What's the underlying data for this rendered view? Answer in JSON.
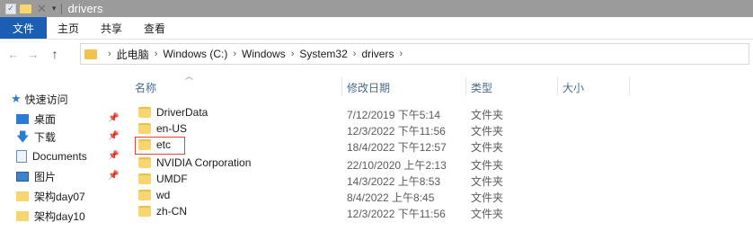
{
  "window": {
    "title": "drivers"
  },
  "quick_access_toolbar": {
    "checkbox_glyph": "✓",
    "delete_glyph": "✕",
    "dropdown_glyph": "▾"
  },
  "ribbon": {
    "tabs": [
      "文件",
      "主页",
      "共享",
      "查看"
    ]
  },
  "nav": {
    "back": "←",
    "forward": "→",
    "up": "↑"
  },
  "address": {
    "sep": "›",
    "crumbs": [
      "此电脑",
      "Windows (C:)",
      "Windows",
      "System32",
      "drivers"
    ]
  },
  "sidebar": {
    "pin_glyph": "📌",
    "items": [
      {
        "label": "快速访问",
        "icon": "star-icon",
        "pinned": false
      },
      {
        "label": "桌面",
        "icon": "desktop-icon",
        "pinned": true
      },
      {
        "label": "下载",
        "icon": "download-icon",
        "pinned": true
      },
      {
        "label": "Documents",
        "icon": "documents-icon",
        "pinned": true
      },
      {
        "label": "图片",
        "icon": "pictures-icon",
        "pinned": true
      },
      {
        "label": "架构day07",
        "icon": "folder-icon",
        "pinned": false
      },
      {
        "label": "架构day10",
        "icon": "folder-icon",
        "pinned": false
      }
    ]
  },
  "columns": {
    "name": "名称",
    "modified": "修改日期",
    "type": "类型",
    "size": "大小",
    "sort_glyph": "︿"
  },
  "files": [
    {
      "name": "DriverData",
      "modified": "7/12/2019 下午5:14",
      "type": "文件夹",
      "highlighted": false
    },
    {
      "name": "en-US",
      "modified": "12/3/2022 下午11:56",
      "type": "文件夹",
      "highlighted": false
    },
    {
      "name": "etc",
      "modified": "18/4/2022 下午12:57",
      "type": "文件夹",
      "highlighted": true
    },
    {
      "name": "NVIDIA Corporation",
      "modified": "22/10/2020 上午2:13",
      "type": "文件夹",
      "highlighted": false
    },
    {
      "name": "UMDF",
      "modified": "14/3/2022 上午8:53",
      "type": "文件夹",
      "highlighted": false
    },
    {
      "name": "wd",
      "modified": "8/4/2022 上午8:45",
      "type": "文件夹",
      "highlighted": false
    },
    {
      "name": "zh-CN",
      "modified": "12/3/2022 下午11:56",
      "type": "文件夹",
      "highlighted": false
    }
  ],
  "colors": {
    "accent": "#1a5fb4",
    "titlebar": "#9b9b9b",
    "folder": "#f7d672",
    "highlight": "#e0463b"
  }
}
